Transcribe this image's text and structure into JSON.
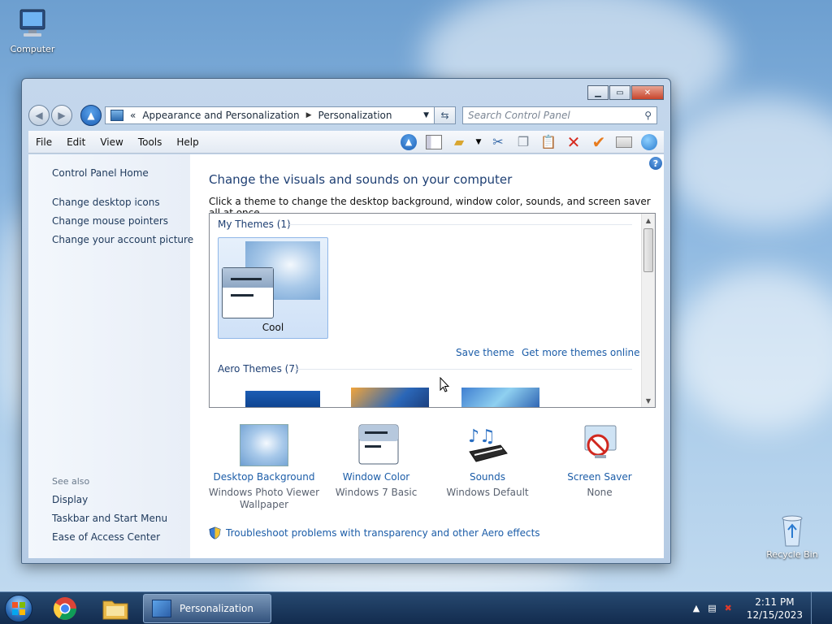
{
  "desktop": {
    "computer_label": "Computer",
    "recycle_label": "Recycle Bin"
  },
  "address": {
    "prefix": "«",
    "crumb1": "Appearance and Personalization",
    "crumb2": "Personalization"
  },
  "search": {
    "placeholder": "Search Control Panel"
  },
  "menu": {
    "file": "File",
    "edit": "Edit",
    "view": "View",
    "tools": "Tools",
    "help": "Help"
  },
  "left": {
    "home": "Control Panel Home",
    "link1": "Change desktop icons",
    "link2": "Change mouse pointers",
    "link3": "Change your account picture",
    "see_also": "See also",
    "sa1": "Display",
    "sa2": "Taskbar and Start Menu",
    "sa3": "Ease of Access Center"
  },
  "main": {
    "title": "Change the visuals and sounds on your computer",
    "desc": "Click a theme to change the desktop background, window color, sounds, and screen saver all at once.",
    "my_themes": "My Themes (1)",
    "theme_name": "Cool",
    "save_theme": "Save theme",
    "get_more": "Get more themes online",
    "aero_themes": "Aero Themes (7)",
    "trouble": "Troubleshoot problems with transparency and other Aero effects"
  },
  "settings": [
    {
      "label": "Desktop Background",
      "value": "Windows Photo Viewer Wallpaper"
    },
    {
      "label": "Window Color",
      "value": "Windows 7 Basic"
    },
    {
      "label": "Sounds",
      "value": "Windows Default"
    },
    {
      "label": "Screen Saver",
      "value": "None"
    }
  ],
  "taskbar": {
    "task_label": "Personalization",
    "time": "2:11 PM",
    "date": "12/15/2023"
  },
  "colors": {
    "link": "#1c5da8",
    "title": "#1e3f73",
    "accent": "#1b5db1"
  }
}
